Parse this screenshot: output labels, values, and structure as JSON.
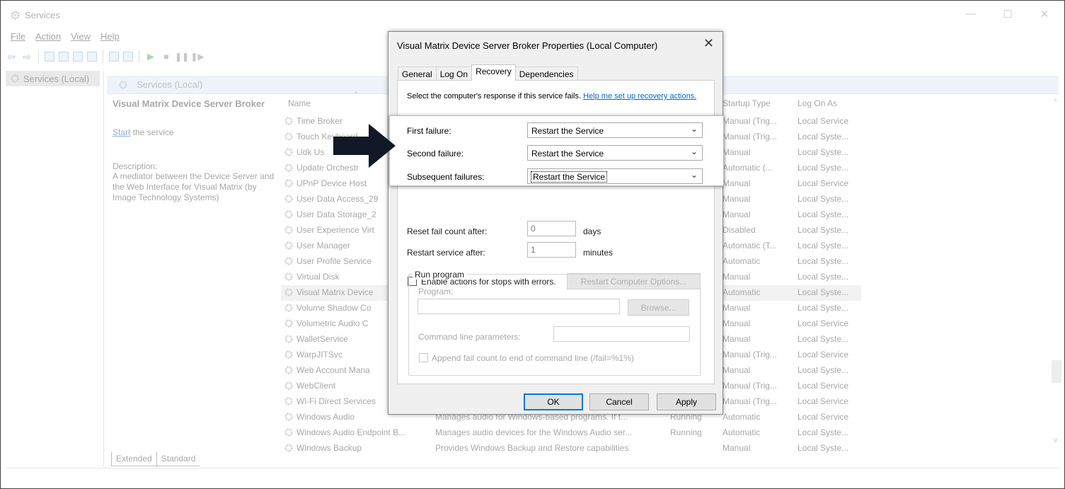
{
  "window": {
    "title": "Services",
    "min": "—",
    "max": "☐",
    "close": "✕"
  },
  "menu": [
    "File",
    "Action",
    "View",
    "Help"
  ],
  "tree": {
    "item": "Services (Local)"
  },
  "pane": {
    "header": "Services (Local)"
  },
  "details": {
    "service_name": "Visual Matrix Device Server Broker",
    "start_link": "Start",
    "start_rest": " the service",
    "desc_label": "Description:",
    "desc_text": "A mediator between the Device Server and the Web Interface for Visual Matrix (by Image Technology Systems)"
  },
  "columns": {
    "name": "Name",
    "startup": "Startup Type",
    "logon": "Log On As"
  },
  "rows": [
    {
      "name": "Time Broker",
      "desc": "",
      "status": "",
      "startup": "Manual (Trig...",
      "logon": "Local Service"
    },
    {
      "name": "Touch Keyboard",
      "desc": "",
      "status": "",
      "startup": "Manual (Trig...",
      "logon": "Local Syste..."
    },
    {
      "name": "Udk Us",
      "desc": "",
      "status": "",
      "startup": "Manual",
      "logon": "Local Syste..."
    },
    {
      "name": "Update Orchestr",
      "desc": "",
      "status": "",
      "startup": "Automatic (...",
      "logon": "Local Syste..."
    },
    {
      "name": "UPnP Device Host",
      "desc": "",
      "status": "",
      "startup": "Manual",
      "logon": "Local Service"
    },
    {
      "name": "User Data Access_29",
      "desc": "",
      "status": "",
      "startup": "Manual",
      "logon": "Local Syste..."
    },
    {
      "name": "User Data Storage_2",
      "desc": "",
      "status": "",
      "startup": "Manual",
      "logon": "Local Syste..."
    },
    {
      "name": "User Experience Virt",
      "desc": "",
      "status": "",
      "startup": "Disabled",
      "logon": "Local Syste..."
    },
    {
      "name": "User Manager",
      "desc": "",
      "status": "",
      "startup": "Automatic (T...",
      "logon": "Local Syste..."
    },
    {
      "name": "User Profile Service",
      "desc": "",
      "status": "",
      "startup": "Automatic",
      "logon": "Local Syste..."
    },
    {
      "name": "Virtual Disk",
      "desc": "",
      "status": "",
      "startup": "Manual",
      "logon": "Local Syste..."
    },
    {
      "name": "Visual Matrix Device",
      "desc": "",
      "status": "",
      "startup": "Automatic",
      "logon": "Local Syste..."
    },
    {
      "name": "Volume Shadow Co",
      "desc": "",
      "status": "",
      "startup": "Manual",
      "logon": "Local Syste..."
    },
    {
      "name": "Volumetric Audio C",
      "desc": "",
      "status": "",
      "startup": "Manual",
      "logon": "Local Service"
    },
    {
      "name": "WalletService",
      "desc": "",
      "status": "",
      "startup": "Manual",
      "logon": "Local Syste..."
    },
    {
      "name": "WarpJITSvc",
      "desc": "",
      "status": "",
      "startup": "Manual (Trig...",
      "logon": "Local Service"
    },
    {
      "name": "Web Account Mana",
      "desc": "",
      "status": "",
      "startup": "Manual",
      "logon": "Local Syste..."
    },
    {
      "name": "WebClient",
      "desc": "",
      "status": "",
      "startup": "Manual (Trig...",
      "logon": "Local Service"
    },
    {
      "name": "Wi-Fi Direct Services",
      "desc": "",
      "status": "",
      "startup": "Manual (Trig...",
      "logon": "Local Service"
    },
    {
      "name": "Windows Audio",
      "desc": "Manages audio for Windows-based programs. If t...",
      "status": "Running",
      "startup": "Automatic",
      "logon": "Local Service"
    },
    {
      "name": "Windows Audio Endpoint B...",
      "desc": "Manages audio devices for the Windows Audio ser...",
      "status": "Running",
      "startup": "Automatic",
      "logon": "Local Syste..."
    },
    {
      "name": "Windows Backup",
      "desc": "Provides Windows Backup and Restore capabilities",
      "status": "",
      "startup": "Manual",
      "logon": "Local Syste..."
    }
  ],
  "bottom_tabs": [
    "Extended",
    "Standard"
  ],
  "dialog": {
    "title": "Visual Matrix Device Server Broker Properties (Local Computer)",
    "close": "✕",
    "tabs": [
      "General",
      "Log On",
      "Recovery",
      "Dependencies"
    ],
    "intro": "Select the computer's response if this service fails. ",
    "intro_link": "Help me set up recovery actions.",
    "first_failure_label": "First failure:",
    "first_failure_value": "Restart the Service",
    "second_failure_label": "Second failure:",
    "second_failure_value": "Restart the Service",
    "subsequent_label": "Subsequent failures:",
    "subsequent_value": "Restart the Service",
    "reset_label": "Reset fail count after:",
    "reset_value": "0",
    "reset_unit": "days",
    "restart_label": "Restart service after:",
    "restart_value": "1",
    "restart_unit": "minutes",
    "enable_label": "Enable actions for stops with errors.",
    "restart_computer_btn": "Restart Computer Options...",
    "run_program_title": "Run program",
    "program_label": "Program:",
    "browse_btn": "Browse...",
    "cmdline_label": "Command line parameters:",
    "append_label": "Append fail count to end of command line (/fail=%1%)",
    "ok": "OK",
    "cancel": "Cancel",
    "apply": "Apply"
  }
}
